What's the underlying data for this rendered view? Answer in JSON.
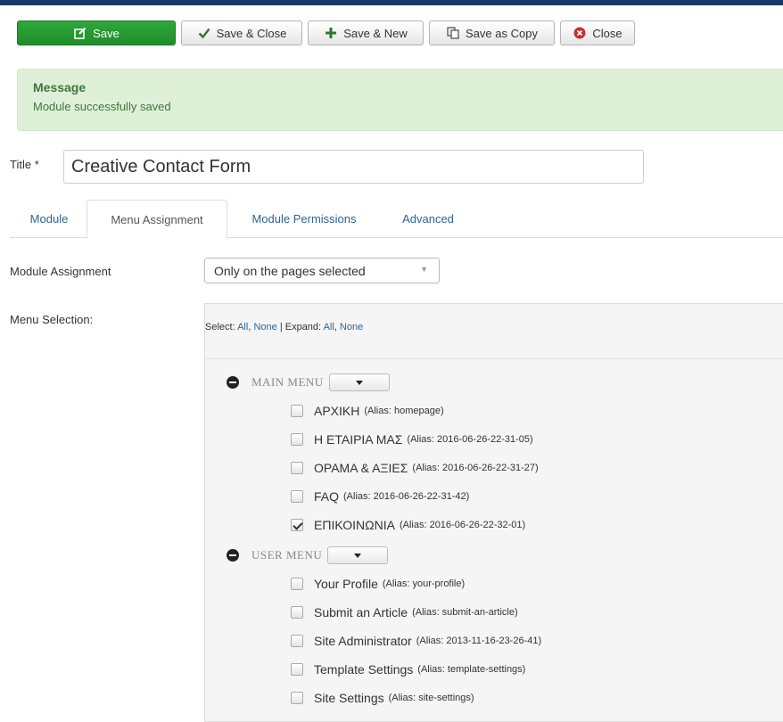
{
  "toolbar": {
    "save": "Save",
    "save_close": "Save & Close",
    "save_new": "Save & New",
    "save_copy": "Save as Copy",
    "close": "Close"
  },
  "message": {
    "heading": "Message",
    "body": "Module successfully saved"
  },
  "title": {
    "label": "Title *",
    "value": "Creative Contact Form"
  },
  "tabs": [
    {
      "label": "Module"
    },
    {
      "label": "Menu Assignment"
    },
    {
      "label": "Module Permissions"
    },
    {
      "label": "Advanced"
    }
  ],
  "assignment": {
    "label": "Module Assignment",
    "selected": "Only on the pages selected"
  },
  "menu_selection": {
    "label": "Menu Selection:",
    "select_label": "Select:",
    "all": "All",
    "comma": ",",
    "none": "None",
    "separator": "|",
    "expand_label": "Expand:",
    "groups": [
      {
        "name": "MAIN MENU",
        "items": [
          {
            "name": "ΑΡΧΙΚΗ",
            "alias": "(Alias: homepage)",
            "checked": false
          },
          {
            "name": "Η ΕΤΑΙΡΙΑ ΜΑΣ",
            "alias": "(Alias: 2016-06-26-22-31-05)",
            "checked": false
          },
          {
            "name": "ΟΡΑΜΑ & ΑΞΙΕΣ",
            "alias": "(Alias: 2016-06-26-22-31-27)",
            "checked": false
          },
          {
            "name": "FAQ",
            "alias": "(Alias: 2016-06-26-22-31-42)",
            "checked": false
          },
          {
            "name": "ΕΠΙΚΟΙΝΩΝΙΑ",
            "alias": "(Alias: 2016-06-26-22-32-01)",
            "checked": true
          }
        ]
      },
      {
        "name": "USER MENU",
        "items": [
          {
            "name": "Your Profile",
            "alias": "(Alias: your-profile)",
            "checked": false
          },
          {
            "name": "Submit an Article",
            "alias": "(Alias: submit-an-article)",
            "checked": false
          },
          {
            "name": "Site Administrator",
            "alias": "(Alias: 2013-11-16-23-26-41)",
            "checked": false
          },
          {
            "name": "Template Settings",
            "alias": "(Alias: template-settings)",
            "checked": false
          },
          {
            "name": "Site Settings",
            "alias": "(Alias: site-settings)",
            "checked": false
          }
        ]
      }
    ]
  }
}
